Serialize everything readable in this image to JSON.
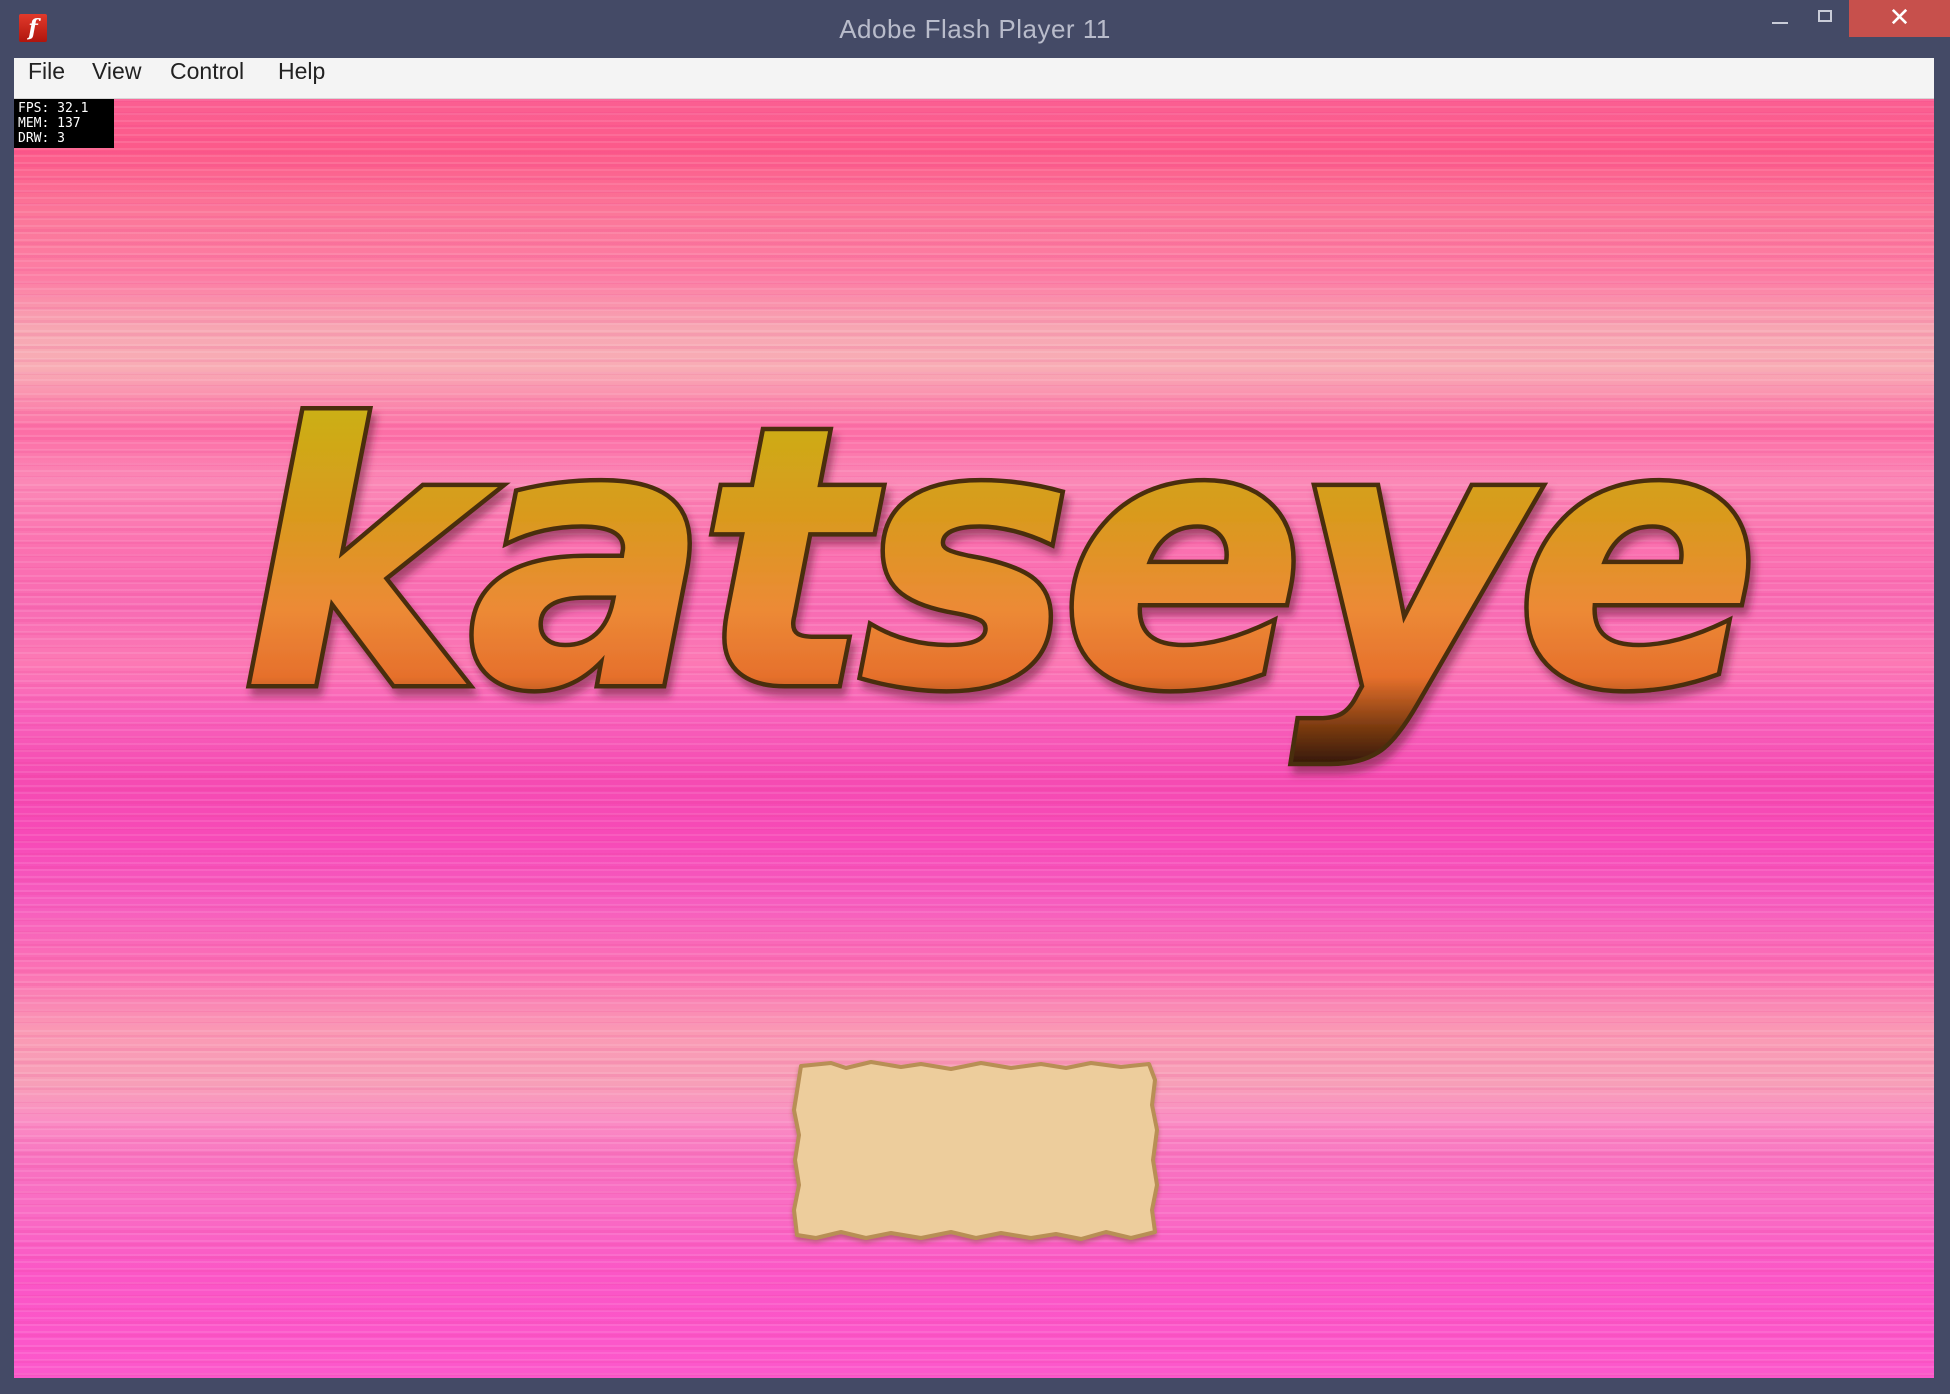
{
  "window": {
    "title": "Adobe Flash Player 11",
    "app_icon_glyph": "f",
    "controls": {
      "minimize_icon": "minimize-icon",
      "maximize_icon": "maximize-icon",
      "close_glyph": "✕"
    }
  },
  "menu": {
    "items": [
      {
        "label": "File"
      },
      {
        "label": "View"
      },
      {
        "label": "Control"
      },
      {
        "label": "Help"
      }
    ]
  },
  "stats": {
    "fps": "FPS: 32.1",
    "mem": "MEM: 137",
    "drw": "DRW: 3"
  },
  "game": {
    "logo_text": "katseye",
    "colors": {
      "logo_top": "#b9a812",
      "logo_mid": "#e89a2c",
      "logo_bottom": "#e76a30",
      "logo_outline": "#5a3a12",
      "parchment": "#edcd9c",
      "parchment_edge": "#b88f55"
    }
  }
}
